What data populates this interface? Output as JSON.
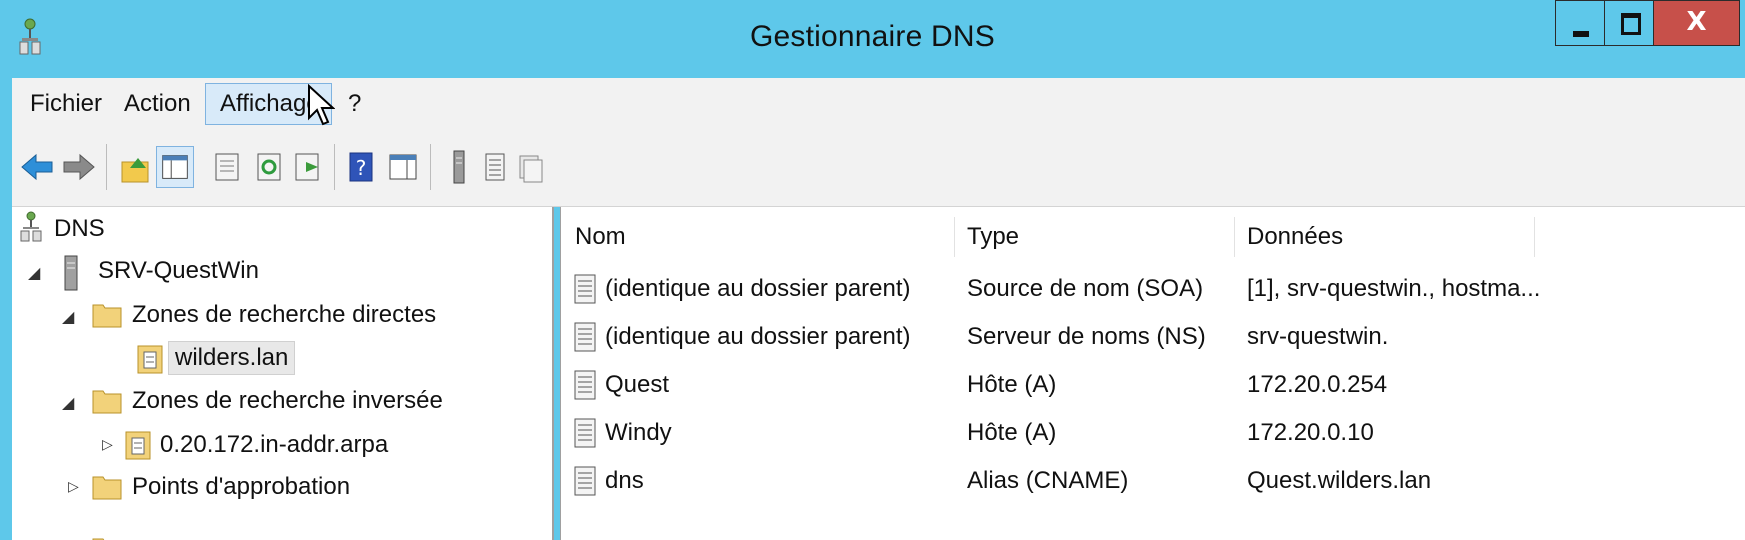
{
  "window": {
    "title": "Gestionnaire DNS",
    "close_glyph": "X"
  },
  "menu": {
    "items": [
      "Fichier",
      "Action",
      "Affichage",
      "?"
    ]
  },
  "toolbar": {
    "icons": [
      "back-arrow-icon",
      "forward-arrow-icon",
      "up-folder-icon",
      "show-hide-tree-icon",
      "properties-icon",
      "refresh-icon",
      "export-list-icon",
      "help-icon",
      "show-action-pane-icon",
      "server-icon",
      "list-view-icon",
      "detail-view-icon"
    ]
  },
  "tree": {
    "root": "DNS",
    "server": "SRV-QuestWin",
    "forward_zones": "Zones de recherche directes",
    "zone_wilders": "wilders.lan",
    "reverse_zones": "Zones de recherche inversée",
    "zone_reverse": "0.20.172.in-addr.arpa",
    "trust_points": "Points d'approbation"
  },
  "list": {
    "columns": [
      "Nom",
      "Type",
      "Données"
    ],
    "rows": [
      {
        "name": "(identique au dossier parent)",
        "type": "Source de nom (SOA)",
        "data": "[1], srv-questwin., hostma..."
      },
      {
        "name": "(identique au dossier parent)",
        "type": "Serveur de noms (NS)",
        "data": "srv-questwin."
      },
      {
        "name": "Quest",
        "type": "Hôte (A)",
        "data": "172.20.0.254"
      },
      {
        "name": "Windy",
        "type": "Hôte (A)",
        "data": "172.20.0.10"
      },
      {
        "name": "dns",
        "type": "Alias (CNAME)",
        "data": "Quest.wilders.lan"
      }
    ]
  },
  "colors": {
    "titlebar": "#5ec8ea",
    "close": "#c7504a",
    "selection": "#d8eaf9"
  }
}
